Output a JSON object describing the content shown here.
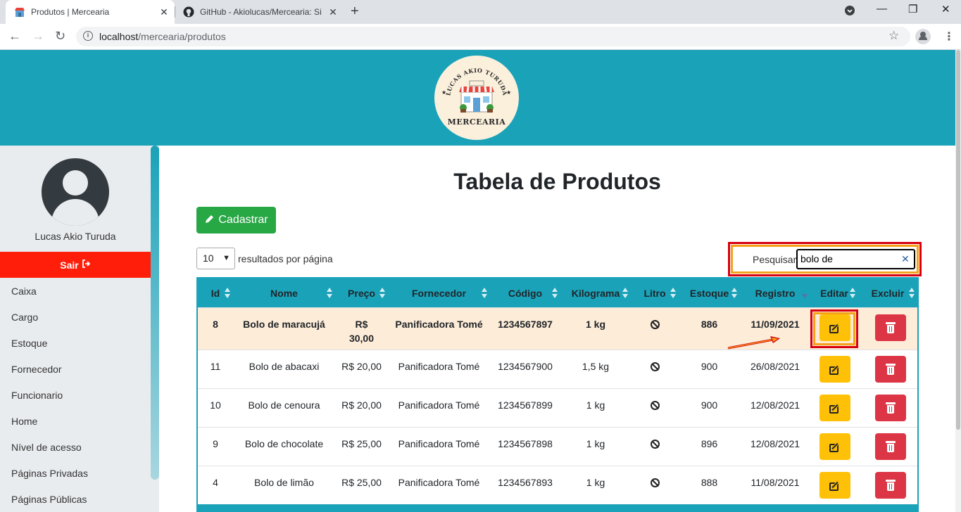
{
  "browser": {
    "tabs": [
      {
        "title": "Produtos | Mercearia",
        "active": true
      },
      {
        "title": "GitHub - Akiolucas/Mercearia: Si",
        "active": false
      }
    ],
    "url_host": "localhost",
    "url_path": "/mercearia/produtos"
  },
  "logo": {
    "arc_text": "LUCAS AKIO TURUDA",
    "name": "MERCEARIA"
  },
  "sidebar": {
    "user_name": "Lucas Akio Turuda",
    "logout_label": "Sair",
    "items": [
      {
        "label": "Caixa"
      },
      {
        "label": "Cargo"
      },
      {
        "label": "Estoque"
      },
      {
        "label": "Fornecedor"
      },
      {
        "label": "Funcionario"
      },
      {
        "label": "Home"
      },
      {
        "label": "Nível de acesso"
      },
      {
        "label": "Páginas Privadas"
      },
      {
        "label": "Páginas Públicas"
      }
    ]
  },
  "main": {
    "title": "Tabela de Produtos",
    "register_label": "Cadastrar",
    "page_length": "10",
    "page_length_suffix": "resultados por página",
    "search_label": "Pesquisar",
    "search_value": "bolo de"
  },
  "table": {
    "columns": [
      "Id",
      "Nome",
      "Preço",
      "Fornecedor",
      "Código",
      "Kilograma",
      "Litro",
      "Estoque",
      "Registro",
      "Editar",
      "Excluir"
    ],
    "sorted_column": "Registro",
    "sort_direction": "desc",
    "rows": [
      {
        "id": "8",
        "nome": "Bolo de maracujá",
        "preco_1": "R$",
        "preco_2": "30,00",
        "fornecedor": "Panificadora Tomé",
        "codigo": "1234567897",
        "kilograma": "1 kg",
        "estoque": "886",
        "registro": "11/09/2021"
      },
      {
        "id": "11",
        "nome": "Bolo de abacaxi",
        "preco_1": "R$ 20,00",
        "preco_2": "",
        "fornecedor": "Panificadora Tomé",
        "codigo": "1234567900",
        "kilograma": "1,5 kg",
        "estoque": "900",
        "registro": "26/08/2021"
      },
      {
        "id": "10",
        "nome": "Bolo de cenoura",
        "preco_1": "R$ 20,00",
        "preco_2": "",
        "fornecedor": "Panificadora Tomé",
        "codigo": "1234567899",
        "kilograma": "1 kg",
        "estoque": "900",
        "registro": "12/08/2021"
      },
      {
        "id": "9",
        "nome": "Bolo de chocolate",
        "preco_1": "R$ 25,00",
        "preco_2": "",
        "fornecedor": "Panificadora Tomé",
        "codigo": "1234567898",
        "kilograma": "1 kg",
        "estoque": "896",
        "registro": "12/08/2021"
      },
      {
        "id": "4",
        "nome": "Bolo de limão",
        "preco_1": "R$ 25,00",
        "preco_2": "",
        "fornecedor": "Panificadora Tomé",
        "codigo": "1234567893",
        "kilograma": "1 kg",
        "estoque": "888",
        "registro": "11/08/2021"
      }
    ]
  },
  "colors": {
    "brand": "#1aa2b9",
    "logout": "#ff1e0a",
    "register": "#28a745",
    "edit": "#ffc107",
    "delete": "#dc3545",
    "highlight_row": "#fdecd8",
    "annotation": "#d7000f"
  },
  "icons": [
    "info-icon",
    "back-icon",
    "forward-icon",
    "reload-icon",
    "star-icon",
    "profile-icon",
    "menu-icon",
    "sort-icon",
    "edit-icon",
    "trash-icon",
    "not-applicable-icon",
    "pencil-icon",
    "logout-icon",
    "clear-icon"
  ]
}
